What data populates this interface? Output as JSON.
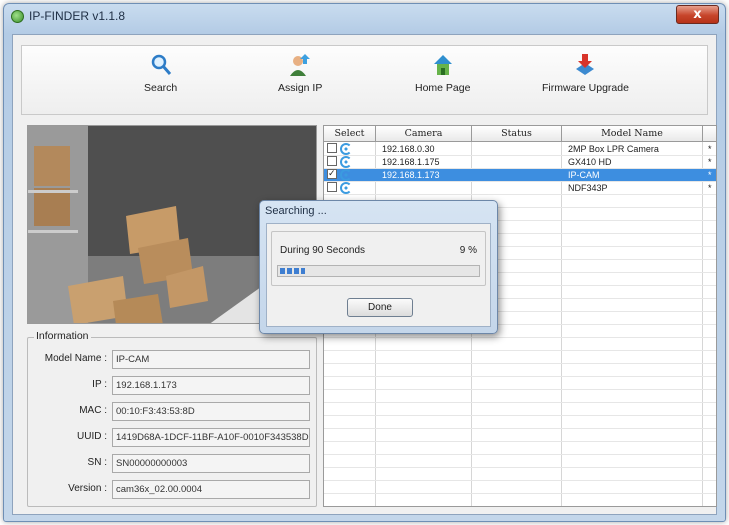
{
  "window": {
    "title": "IP-FINDER v1.1.8",
    "close_glyph": "x"
  },
  "toolbar": {
    "items": [
      {
        "label": "Search",
        "icon": "magnifier-icon"
      },
      {
        "label": "Assign IP",
        "icon": "assign-ip-icon"
      },
      {
        "label": "Home Page",
        "icon": "home-icon"
      },
      {
        "label": "Firmware Upgrade",
        "icon": "firmware-icon"
      }
    ]
  },
  "info": {
    "legend": "Information",
    "rows": [
      {
        "label": "Model Name :",
        "value": "IP-CAM"
      },
      {
        "label": "IP :",
        "value": "192.168.1.173"
      },
      {
        "label": "MAC :",
        "value": "00:10:F3:43:53:8D"
      },
      {
        "label": "UUID :",
        "value": "1419D68A-1DCF-11BF-A10F-0010F343538D"
      },
      {
        "label": "SN :",
        "value": "SN00000000003"
      },
      {
        "label": "Version :",
        "value": "cam36x_02.00.0004"
      }
    ]
  },
  "grid": {
    "columns": [
      "Select",
      "Camera",
      "Status",
      "Model Name"
    ],
    "rows": [
      {
        "checked": false,
        "camera": "192.168.0.30",
        "status": "",
        "model": "2MP Box LPR Camera",
        "mark": "*",
        "selected": false
      },
      {
        "checked": false,
        "camera": "192.168.1.175",
        "status": "",
        "model": "GX410 HD",
        "mark": "*",
        "selected": false
      },
      {
        "checked": true,
        "camera": "192.168.1.173",
        "status": "",
        "model": "IP-CAM",
        "mark": "*",
        "selected": true
      },
      {
        "checked": false,
        "camera": "",
        "status": "",
        "model": "NDF343P",
        "mark": "*",
        "selected": false
      }
    ]
  },
  "dialog": {
    "title": "Searching ...",
    "label": "During 90 Seconds",
    "percent_text": "9 %",
    "progress": 0.09,
    "done_label": "Done"
  },
  "colors": {
    "selection": "#3d8ee0",
    "progress": "#3e7ed1",
    "close": "#c7452b"
  }
}
